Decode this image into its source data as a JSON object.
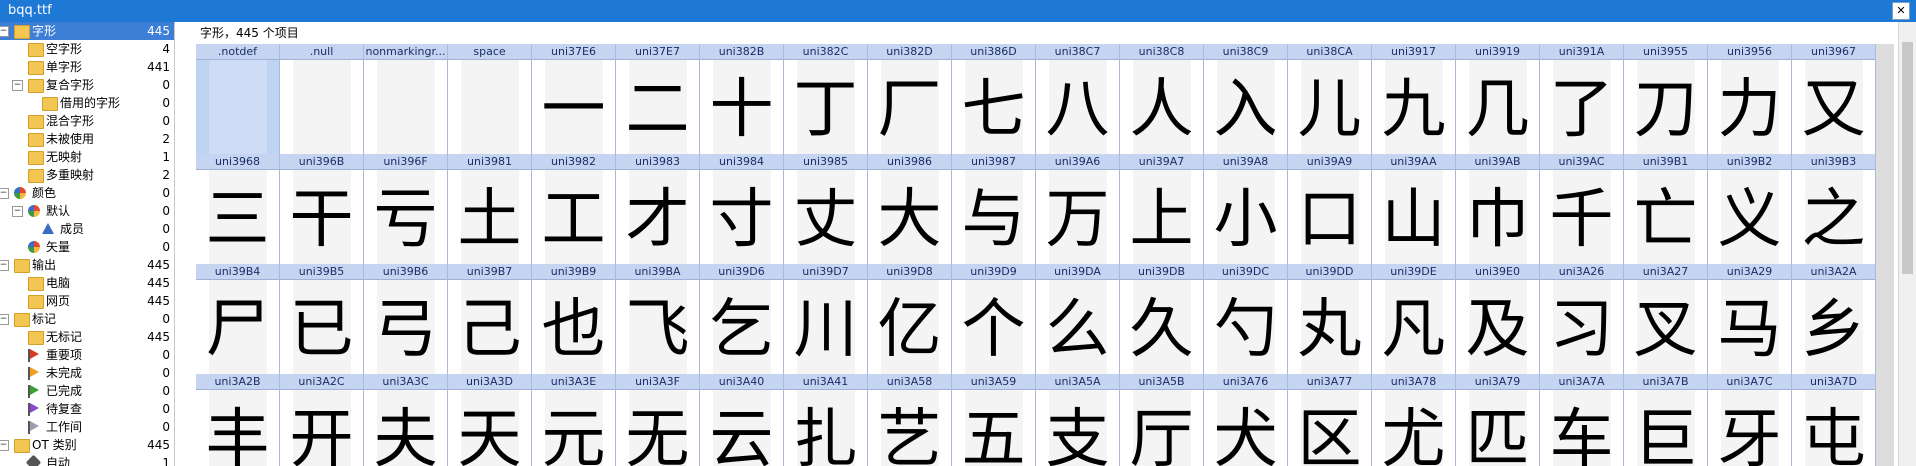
{
  "window": {
    "title": "bqq.ttf",
    "close_glyph": "✕"
  },
  "tree": [
    {
      "label": "字形",
      "count": "445",
      "icon": "folder-icon",
      "level": 0,
      "expander": "−",
      "selected": true
    },
    {
      "label": "空字形",
      "count": "4",
      "icon": "folder-icon",
      "level": 1
    },
    {
      "label": "单字形",
      "count": "441",
      "icon": "folder-icon",
      "level": 1
    },
    {
      "label": "复合字形",
      "count": "0",
      "icon": "folder-icon",
      "level": 1,
      "expander": "−"
    },
    {
      "label": "借用的字形",
      "count": "0",
      "icon": "folder-icon",
      "level": 2
    },
    {
      "label": "混合字形",
      "count": "0",
      "icon": "folder-icon",
      "level": 1
    },
    {
      "label": "未被使用",
      "count": "2",
      "icon": "folder-icon",
      "level": 1
    },
    {
      "label": "无映射",
      "count": "1",
      "icon": "folder-icon",
      "level": 1
    },
    {
      "label": "多重映射",
      "count": "2",
      "icon": "folder-icon",
      "level": 1
    },
    {
      "label": "颜色",
      "count": "0",
      "icon": "color-pie-icon",
      "level": 0,
      "expander": "−"
    },
    {
      "label": "默认",
      "count": "0",
      "icon": "color-pie-icon",
      "level": 1,
      "expander": "−"
    },
    {
      "label": "成员",
      "count": "0",
      "icon": "triangle-icon",
      "level": 2
    },
    {
      "label": "矢量",
      "count": "0",
      "icon": "color-pie-icon",
      "level": 1
    },
    {
      "label": "输出",
      "count": "445",
      "icon": "folder-icon",
      "level": 0,
      "expander": "−"
    },
    {
      "label": "电脑",
      "count": "445",
      "icon": "folder-icon",
      "level": 1
    },
    {
      "label": "网页",
      "count": "445",
      "icon": "folder-icon",
      "level": 1
    },
    {
      "label": "标记",
      "count": "0",
      "icon": "folder-icon",
      "level": 0,
      "expander": "−"
    },
    {
      "label": "无标记",
      "count": "445",
      "icon": "folder-icon",
      "level": 1
    },
    {
      "label": "重要项",
      "count": "0",
      "icon": "flag-icon",
      "flag_color": "#d83a2a",
      "level": 1
    },
    {
      "label": "未完成",
      "count": "0",
      "icon": "flag-icon",
      "flag_color": "#f0a020",
      "level": 1
    },
    {
      "label": "已完成",
      "count": "0",
      "icon": "flag-icon",
      "flag_color": "#3aa03a",
      "level": 1
    },
    {
      "label": "待复查",
      "count": "0",
      "icon": "flag-icon",
      "flag_color": "#8a4bc8",
      "level": 1
    },
    {
      "label": "工作间",
      "count": "0",
      "icon": "flag-icon",
      "flag_color": "#9aa0b0",
      "level": 1
    },
    {
      "label": "OT 类别",
      "count": "445",
      "icon": "folder-icon",
      "level": 0,
      "expander": "−"
    },
    {
      "label": "自动",
      "count": "1",
      "icon": "brush-icon",
      "level": 1
    }
  ],
  "main": {
    "caption": "字形，445 个项目"
  },
  "glyph_rows": [
    [
      {
        "name": ".notdef",
        "char": "",
        "selected": true
      },
      {
        "name": ".null",
        "char": ""
      },
      {
        "name": "nonmarkingr...",
        "char": ""
      },
      {
        "name": "space",
        "char": ""
      },
      {
        "name": "uni37E6",
        "char": "一"
      },
      {
        "name": "uni37E7",
        "char": "二"
      },
      {
        "name": "uni382B",
        "char": "十"
      },
      {
        "name": "uni382C",
        "char": "丁"
      },
      {
        "name": "uni382D",
        "char": "厂"
      },
      {
        "name": "uni386D",
        "char": "七"
      },
      {
        "name": "uni38C7",
        "char": "八"
      },
      {
        "name": "uni38C8",
        "char": "人"
      },
      {
        "name": "uni38C9",
        "char": "入"
      },
      {
        "name": "uni38CA",
        "char": "儿"
      },
      {
        "name": "uni3917",
        "char": "九"
      },
      {
        "name": "uni3919",
        "char": "几"
      },
      {
        "name": "uni391A",
        "char": "了"
      },
      {
        "name": "uni3955",
        "char": "刀"
      },
      {
        "name": "uni3956",
        "char": "力"
      },
      {
        "name": "uni3967",
        "char": "又"
      }
    ],
    [
      {
        "name": "uni3968",
        "char": "三"
      },
      {
        "name": "uni396B",
        "char": "干"
      },
      {
        "name": "uni396F",
        "char": "亏"
      },
      {
        "name": "uni3981",
        "char": "土"
      },
      {
        "name": "uni3982",
        "char": "工"
      },
      {
        "name": "uni3983",
        "char": "才"
      },
      {
        "name": "uni3984",
        "char": "寸"
      },
      {
        "name": "uni3985",
        "char": "丈"
      },
      {
        "name": "uni3986",
        "char": "大"
      },
      {
        "name": "uni3987",
        "char": "与"
      },
      {
        "name": "uni39A6",
        "char": "万"
      },
      {
        "name": "uni39A7",
        "char": "上"
      },
      {
        "name": "uni39A8",
        "char": "小"
      },
      {
        "name": "uni39A9",
        "char": "口"
      },
      {
        "name": "uni39AA",
        "char": "山"
      },
      {
        "name": "uni39AB",
        "char": "巾"
      },
      {
        "name": "uni39AC",
        "char": "千"
      },
      {
        "name": "uni39B1",
        "char": "亡"
      },
      {
        "name": "uni39B2",
        "char": "义"
      },
      {
        "name": "uni39B3",
        "char": "之"
      }
    ],
    [
      {
        "name": "uni39B4",
        "char": "尸"
      },
      {
        "name": "uni39B5",
        "char": "已"
      },
      {
        "name": "uni39B6",
        "char": "弓"
      },
      {
        "name": "uni39B7",
        "char": "己"
      },
      {
        "name": "uni39B9",
        "char": "也"
      },
      {
        "name": "uni39BA",
        "char": "飞"
      },
      {
        "name": "uni39D6",
        "char": "乞"
      },
      {
        "name": "uni39D7",
        "char": "川"
      },
      {
        "name": "uni39D8",
        "char": "亿"
      },
      {
        "name": "uni39D9",
        "char": "个"
      },
      {
        "name": "uni39DA",
        "char": "么"
      },
      {
        "name": "uni39DB",
        "char": "久"
      },
      {
        "name": "uni39DC",
        "char": "勺"
      },
      {
        "name": "uni39DD",
        "char": "丸"
      },
      {
        "name": "uni39DE",
        "char": "凡"
      },
      {
        "name": "uni39E0",
        "char": "及"
      },
      {
        "name": "uni3A26",
        "char": "习"
      },
      {
        "name": "uni3A27",
        "char": "叉"
      },
      {
        "name": "uni3A29",
        "char": "马"
      },
      {
        "name": "uni3A2A",
        "char": "乡"
      }
    ],
    [
      {
        "name": "uni3A2B",
        "char": "丰"
      },
      {
        "name": "uni3A2C",
        "char": "开"
      },
      {
        "name": "uni3A3C",
        "char": "夫"
      },
      {
        "name": "uni3A3D",
        "char": "天"
      },
      {
        "name": "uni3A3E",
        "char": "元"
      },
      {
        "name": "uni3A3F",
        "char": "无"
      },
      {
        "name": "uni3A40",
        "char": "云"
      },
      {
        "name": "uni3A41",
        "char": "扎"
      },
      {
        "name": "uni3A58",
        "char": "艺"
      },
      {
        "name": "uni3A59",
        "char": "五"
      },
      {
        "name": "uni3A5A",
        "char": "支"
      },
      {
        "name": "uni3A5B",
        "char": "厅"
      },
      {
        "name": "uni3A76",
        "char": "犬"
      },
      {
        "name": "uni3A77",
        "char": "区"
      },
      {
        "name": "uni3A78",
        "char": "尤"
      },
      {
        "name": "uni3A79",
        "char": "匹"
      },
      {
        "name": "uni3A7A",
        "char": "车"
      },
      {
        "name": "uni3A7B",
        "char": "巨"
      },
      {
        "name": "uni3A7C",
        "char": "牙"
      },
      {
        "name": "uni3A7D",
        "char": "屯"
      }
    ]
  ]
}
